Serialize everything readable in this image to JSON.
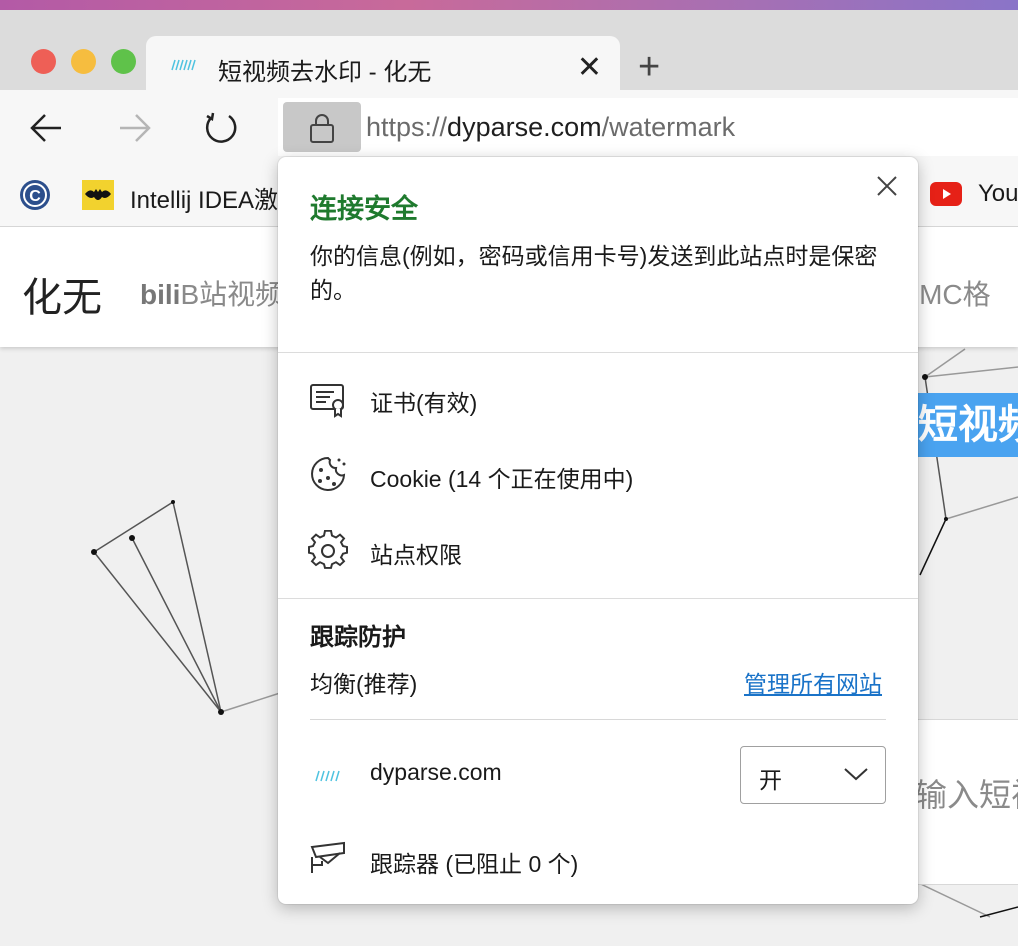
{
  "tab": {
    "title": "短视频去水印 - 化无"
  },
  "address_bar": {
    "url_scheme": "https://",
    "url_host": "dyparse.com",
    "url_path": "/watermark"
  },
  "bookmarks": [
    {
      "label": "",
      "icon": "c-logo-icon"
    },
    {
      "label": "Intellij IDEA激",
      "icon": "batman-icon"
    },
    {
      "label": "You",
      "icon": "youtube-icon"
    }
  ],
  "page": {
    "brand": "化无",
    "nav_bilibili": "B站视频",
    "nav_qmc": ")QMC格",
    "headline_partial": "短视频",
    "input_placeholder_partial": "输入短视"
  },
  "popup": {
    "title": "连接安全",
    "description": "你的信息(例如，密码或信用卡号)发送到此站点时是保密的。",
    "items": [
      {
        "label": "证书(有效)",
        "icon": "certificate-icon"
      },
      {
        "label": "Cookie (14 个正在使用中)",
        "icon": "cookie-icon"
      },
      {
        "label": "站点权限",
        "icon": "gear-icon"
      }
    ],
    "tracking": {
      "title": "跟踪防护",
      "mode": "均衡(推荐)",
      "manage_link": "管理所有网站",
      "site": "dyparse.com",
      "toggle_value": "开",
      "trackers": "跟踪器 (已阻止 0 个)"
    }
  },
  "colors": {
    "secure_green": "#1f7a2e",
    "link_blue": "#1a73c8",
    "headline_blue": "#4aa3f0"
  }
}
